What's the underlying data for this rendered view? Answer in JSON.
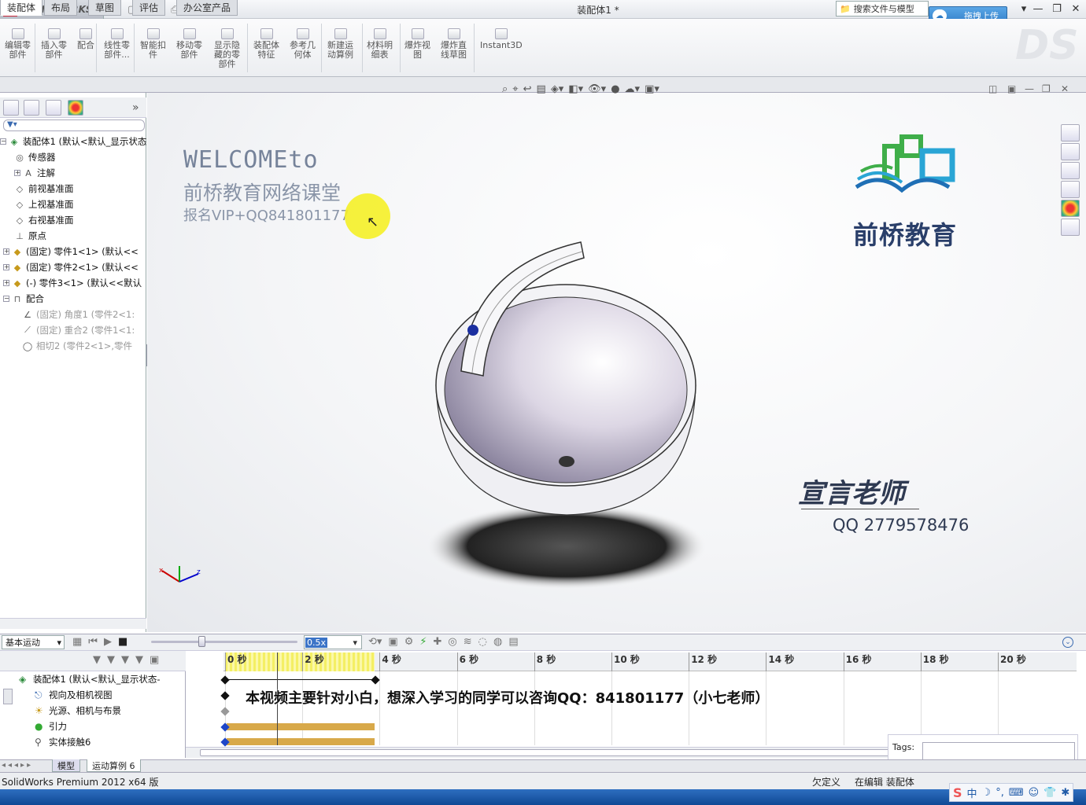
{
  "app": {
    "logo": "SOLIDWORKS",
    "window_title": "装配体1 *",
    "search_label": "搜索文件与模型",
    "upload_button": "拖拽上传"
  },
  "ribbon": {
    "buttons": [
      {
        "label": "编辑零\n部件"
      },
      {
        "label": "插入零\n部件"
      },
      {
        "label": "配合"
      },
      {
        "label": "线性零\n部件..."
      },
      {
        "label": "智能扣\n件"
      },
      {
        "label": "移动零\n部件"
      },
      {
        "label": "显示隐\n藏的零\n部件"
      },
      {
        "label": "装配体\n特征"
      },
      {
        "label": "参考几\n何体"
      },
      {
        "label": "新建运\n动算例"
      },
      {
        "label": "材料明\n细表"
      },
      {
        "label": "爆炸视\n图"
      },
      {
        "label": "爆炸直\n线草图"
      },
      {
        "label": "Instant3D"
      }
    ]
  },
  "tabs": [
    "装配体",
    "布局",
    "草图",
    "评估",
    "办公室产品"
  ],
  "feature_tree": {
    "rows": [
      {
        "label": "装配体1 (默认<默认_显示状态",
        "icon": "assembly-icon"
      },
      {
        "label": "传感器",
        "icon": "sensor-icon"
      },
      {
        "label": "注解",
        "icon": "annotation-icon"
      },
      {
        "label": "前视基准面",
        "icon": "plane-icon"
      },
      {
        "label": "上视基准面",
        "icon": "plane-icon"
      },
      {
        "label": "右视基准面",
        "icon": "plane-icon"
      },
      {
        "label": "原点",
        "icon": "origin-icon"
      },
      {
        "label": "(固定) 零件1<1> (默认<<",
        "icon": "part-icon"
      },
      {
        "label": "(固定) 零件2<1> (默认<<",
        "icon": "part-icon"
      },
      {
        "label": "(-) 零件3<1> (默认<<默认",
        "icon": "part-icon"
      },
      {
        "label": "配合",
        "icon": "mates-icon"
      },
      {
        "label": "(固定) 角度1 (零件2<1:",
        "icon": "angle-mate-icon"
      },
      {
        "label": "(固定) 重合2 (零件1<1:",
        "icon": "coincident-mate-icon"
      },
      {
        "label": "相切2 (零件2<1>,零件",
        "icon": "tangent-mate-icon"
      }
    ]
  },
  "viewport": {
    "welcome_line1": "WELCOMEto",
    "welcome_line2": "前桥教育网络课堂",
    "welcome_line3": "报名VIP+QQ841801177",
    "brand_name": "前桥教育",
    "teacher": "宣言老师",
    "teacher_qq": "QQ 2779578476"
  },
  "motion": {
    "study_type": "基本运动",
    "speed": "0.5x",
    "tree_rows": [
      {
        "label": "装配体1 (默认<默认_显示状态-",
        "icon": "assembly-icon"
      },
      {
        "label": "视向及相机视图",
        "icon": "camera-icon"
      },
      {
        "label": "光源、相机与布景",
        "icon": "lights-icon"
      },
      {
        "label": "引力",
        "icon": "gravity-icon"
      },
      {
        "label": "实体接触6",
        "icon": "contact-icon"
      }
    ],
    "ticks": [
      "0 秒",
      "2 秒",
      "4 秒",
      "6 秒",
      "8 秒",
      "10 秒",
      "12 秒",
      "14 秒",
      "16 秒",
      "18 秒",
      "20 秒"
    ],
    "subtitle": "本视频主要针对小白，想深入学习的同学可以咨询QQ：841801177（小七老师）",
    "tags_label": "Tags:"
  },
  "bottom_tabs": [
    "模型",
    "运动算例 6"
  ],
  "status": {
    "product": "SolidWorks Premium 2012 x64 版",
    "state1": "欠定义",
    "state2": "在编辑 装配体"
  },
  "ime": {
    "label": "中"
  }
}
